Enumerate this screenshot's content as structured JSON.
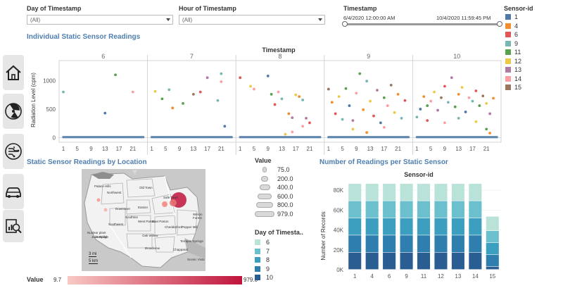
{
  "filters": {
    "day": {
      "label": "Day of Timestamp",
      "value": "(All)"
    },
    "hour": {
      "label": "Hour of Timestamp",
      "value": "(All)"
    },
    "timestamp": {
      "label": "Timestamp",
      "start": "6/4/2020 12:00:00 AM",
      "end": "10/4/2020 11:59:45 PM"
    }
  },
  "sensor_legend": {
    "title": "Sensor-id",
    "items": [
      {
        "label": "1",
        "color": "#4e79a7"
      },
      {
        "label": "4",
        "color": "#f28e2b"
      },
      {
        "label": "6",
        "color": "#e15759"
      },
      {
        "label": "9",
        "color": "#76b7b2"
      },
      {
        "label": "11",
        "color": "#59a14f"
      },
      {
        "label": "12",
        "color": "#edc948"
      },
      {
        "label": "13",
        "color": "#b07aa1"
      },
      {
        "label": "14",
        "color": "#ff9da7"
      },
      {
        "label": "15",
        "color": "#9c755f"
      }
    ]
  },
  "nav": [
    "home-icon",
    "radiation-icon",
    "circuit-icon",
    "car-icon",
    "report-search-icon"
  ],
  "readings_chart": {
    "title": "Individual Static Sensor Readings",
    "header": "Timestamp",
    "ylabel": "Radiation Level (cpm)"
  },
  "map": {
    "title": "Static Sensor Readings by Location",
    "districts": [
      "Palace Hills",
      "Northwest",
      "Old Town",
      "Downtown",
      "Southton",
      "Easton",
      "Southwest",
      "West Parton",
      "East Parton",
      "Cheddarford",
      "Oak Willow",
      "Pepper Mill",
      "Broadview",
      "Terrapin Springs",
      "Safe Town",
      "Wilson Forest",
      "Chapparal",
      "Jade Bridge",
      "Scenic Vista"
    ],
    "poi": [
      "Nuclear plant",
      "Hospital"
    ],
    "scale": [
      "3 mi",
      "5 km"
    ]
  },
  "size_legend": {
    "title": "Value",
    "items": [
      "75.0",
      "200.0",
      "400.0",
      "600.0",
      "800.0",
      "979.0"
    ]
  },
  "day_legend": {
    "title": "Day of Timesta..",
    "items": [
      {
        "label": "6",
        "color": "#b9e3d9"
      },
      {
        "label": "7",
        "color": "#6cbfcc"
      },
      {
        "label": "8",
        "color": "#3d9fbf"
      },
      {
        "label": "9",
        "color": "#2e7fae"
      },
      {
        "label": "10",
        "color": "#2a5e93"
      }
    ]
  },
  "value_legend": {
    "title": "Value",
    "min": "9.7",
    "max": "979.0",
    "color_low": "#f9c9c4",
    "color_high": "#c0143c"
  },
  "chart_data": [
    {
      "type": "scatter",
      "title": "Individual Static Sensor Readings",
      "header": "Timestamp",
      "xlabel": "",
      "ylabel": "Radiation Level (cpm)",
      "panels": [
        "6",
        "7",
        "8",
        "9",
        "10"
      ],
      "hour_ticks": [
        "1",
        "5",
        "9",
        "13",
        "17",
        "21"
      ],
      "yticks": [
        0,
        500,
        1000
      ],
      "ylim": [
        -80,
        1350
      ],
      "baseline_value": 10,
      "series": [
        {
          "name": "6",
          "points": [
            [
              1,
              800,
              "9"
            ],
            [
              13,
              430,
              "1"
            ],
            [
              16,
              1100,
              "11"
            ],
            [
              21,
              800,
              "14"
            ]
          ]
        },
        {
          "name": "7",
          "points": [
            [
              2,
              810,
              "12"
            ],
            [
              4,
              680,
              "11"
            ],
            [
              6,
              840,
              "9"
            ],
            [
              7,
              520,
              "4"
            ],
            [
              10,
              600,
              "11"
            ],
            [
              13,
              760,
              "15"
            ],
            [
              15,
              800,
              "6"
            ],
            [
              17,
              1050,
              "13"
            ],
            [
              20,
              650,
              "9"
            ],
            [
              21,
              1120,
              "9"
            ],
            [
              21,
              980,
              "14"
            ],
            [
              22,
              200,
              "1"
            ]
          ]
        },
        {
          "name": "8",
          "points": [
            [
              1,
              1050,
              "6"
            ],
            [
              4,
              900,
              "12"
            ],
            [
              5,
              850,
              "14"
            ],
            [
              9,
              1080,
              "1"
            ],
            [
              10,
              760,
              "11"
            ],
            [
              11,
              580,
              "6"
            ],
            [
              12,
              800,
              "14"
            ],
            [
              13,
              680,
              "9"
            ],
            [
              15,
              420,
              "4"
            ],
            [
              16,
              350,
              "13"
            ],
            [
              17,
              750,
              "12"
            ],
            [
              18,
              720,
              "4"
            ],
            [
              19,
              660,
              "9"
            ],
            [
              19,
              200,
              "14"
            ],
            [
              20,
              340,
              "13"
            ],
            [
              21,
              260,
              "6"
            ],
            [
              14,
              60,
              "12"
            ],
            [
              16,
              100,
              "14"
            ]
          ]
        },
        {
          "name": "9",
          "points": [
            [
              1,
              850,
              "15"
            ],
            [
              2,
              620,
              "4"
            ],
            [
              3,
              420,
              "6"
            ],
            [
              4,
              720,
              "12"
            ],
            [
              5,
              320,
              "9"
            ],
            [
              6,
              860,
              "11"
            ],
            [
              7,
              560,
              "1"
            ],
            [
              8,
              300,
              "13"
            ],
            [
              9,
              780,
              "14"
            ],
            [
              10,
              1120,
              "11"
            ],
            [
              11,
              490,
              "4"
            ],
            [
              12,
              990,
              "9"
            ],
            [
              13,
              640,
              "12"
            ],
            [
              14,
              380,
              "6"
            ],
            [
              15,
              830,
              "13"
            ],
            [
              16,
              260,
              "1"
            ],
            [
              17,
              700,
              "11"
            ],
            [
              18,
              560,
              "14"
            ],
            [
              19,
              920,
              "15"
            ],
            [
              20,
              440,
              "12"
            ],
            [
              21,
              760,
              "4"
            ],
            [
              22,
              340,
              "9"
            ],
            [
              23,
              650,
              "6"
            ],
            [
              8,
              150,
              "12"
            ],
            [
              12,
              90,
              "4"
            ],
            [
              17,
              180,
              "14"
            ]
          ]
        },
        {
          "name": "10",
          "points": [
            [
              1,
              360,
              "9"
            ],
            [
              2,
              500,
              "1"
            ],
            [
              3,
              720,
              "4"
            ],
            [
              4,
              560,
              "11"
            ],
            [
              5,
              640,
              "14"
            ],
            [
              6,
              800,
              "12"
            ],
            [
              7,
              480,
              "13"
            ],
            [
              8,
              700,
              "15"
            ],
            [
              9,
              900,
              "6"
            ],
            [
              10,
              620,
              "9"
            ],
            [
              11,
              1050,
              "13"
            ],
            [
              12,
              540,
              "11"
            ],
            [
              13,
              760,
              "4"
            ],
            [
              14,
              880,
              "12"
            ],
            [
              15,
              450,
              "1"
            ],
            [
              16,
              700,
              "14"
            ],
            [
              17,
              640,
              "9"
            ],
            [
              18,
              820,
              "6"
            ],
            [
              19,
              560,
              "11"
            ],
            [
              20,
              730,
              "15"
            ],
            [
              21,
              600,
              "12"
            ],
            [
              22,
              420,
              "13"
            ],
            [
              23,
              690,
              "4"
            ],
            [
              4,
              300,
              "6"
            ],
            [
              9,
              260,
              "14"
            ],
            [
              13,
              340,
              "9"
            ],
            [
              18,
              280,
              "12"
            ],
            [
              21,
              150,
              "11"
            ],
            [
              22,
              80,
              "4"
            ]
          ]
        }
      ]
    },
    {
      "type": "bar",
      "title": "Number of Readings per Static Sensor",
      "header": "Sensor-id",
      "xlabel": "",
      "ylabel": "Number of Records",
      "categories": [
        "1",
        "4",
        "6",
        "9",
        "11",
        "12",
        "13",
        "14",
        "15"
      ],
      "ylim": [
        0,
        90000
      ],
      "yticks": [
        "0K",
        "20K",
        "40K",
        "60K",
        "80K"
      ],
      "series": [
        {
          "name": "10",
          "values": [
            17280,
            17280,
            17280,
            17280,
            17280,
            17280,
            17280,
            17280,
            3000
          ]
        },
        {
          "name": "9",
          "values": [
            17280,
            17280,
            17280,
            17280,
            17280,
            17280,
            17280,
            17280,
            12000
          ]
        },
        {
          "name": "8",
          "values": [
            17280,
            17280,
            17280,
            17280,
            17280,
            17280,
            17280,
            17280,
            12000
          ]
        },
        {
          "name": "7",
          "values": [
            17280,
            17280,
            17280,
            17280,
            17280,
            17280,
            17280,
            17280,
            12000
          ]
        },
        {
          "name": "6",
          "values": [
            17280,
            17280,
            17280,
            17280,
            17280,
            17280,
            17280,
            17280,
            14500
          ]
        }
      ]
    }
  ]
}
